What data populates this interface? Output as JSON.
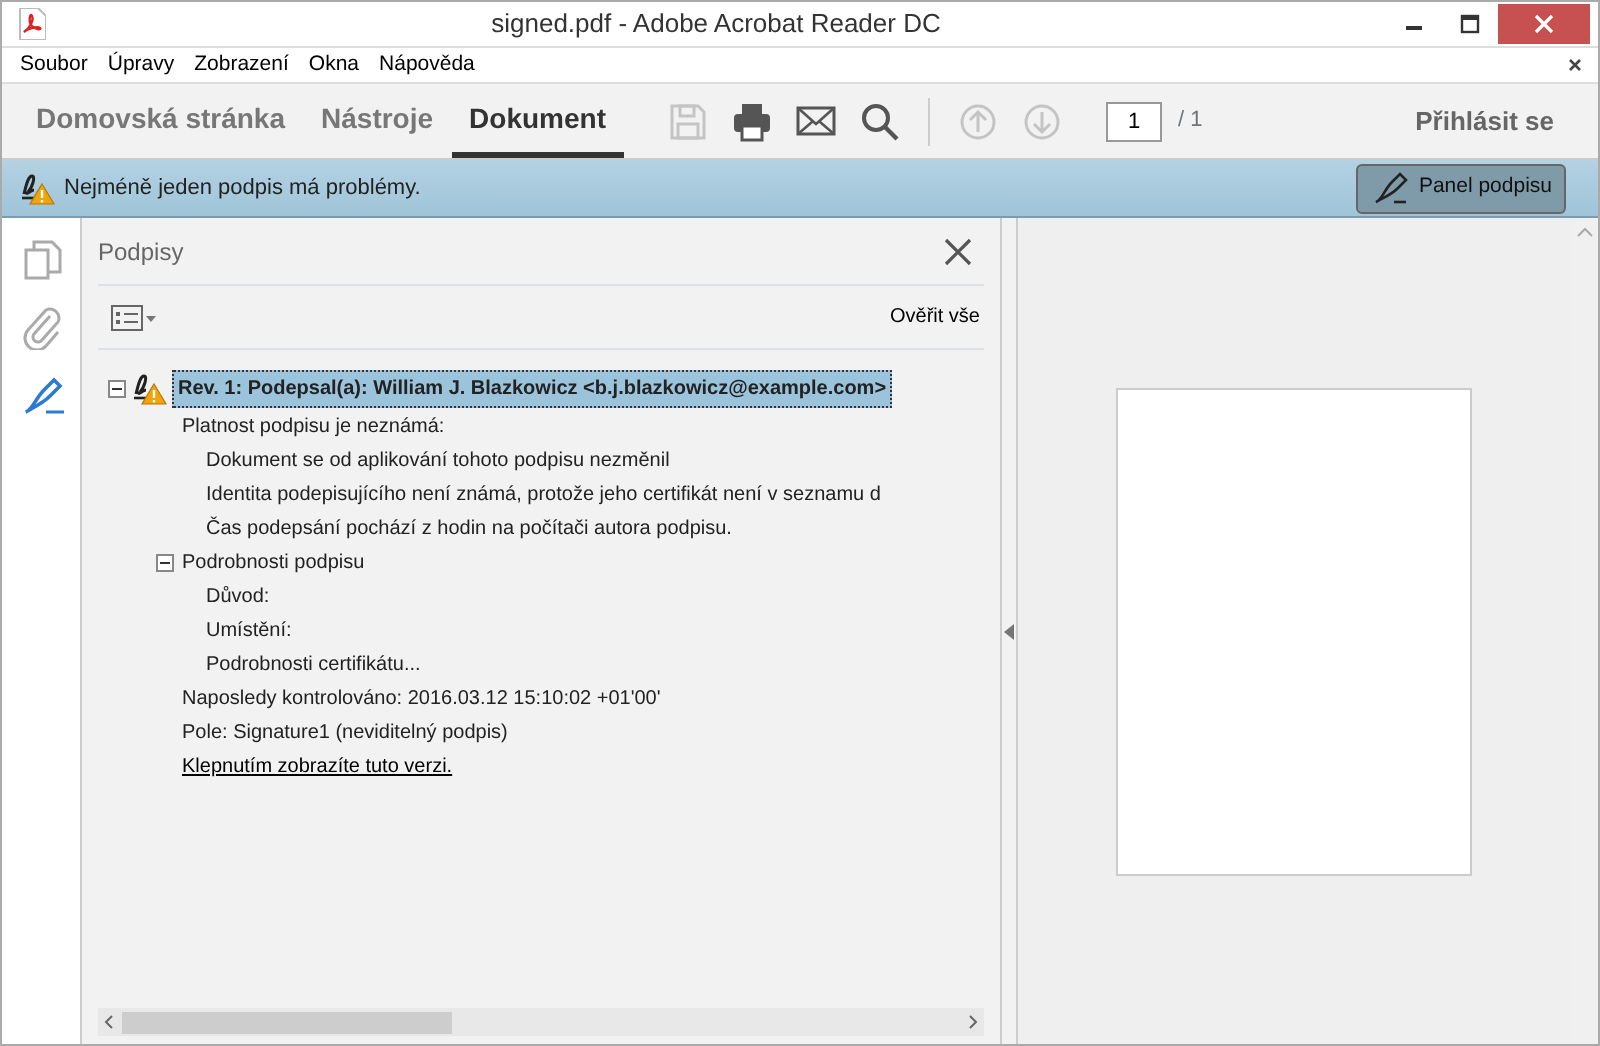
{
  "window": {
    "title": "signed.pdf - Adobe Acrobat Reader DC"
  },
  "menu": [
    "Soubor",
    "Úpravy",
    "Zobrazení",
    "Okna",
    "Nápověda"
  ],
  "toolbar": {
    "tabs": [
      {
        "label": "Domovská stránka",
        "selected": false
      },
      {
        "label": "Nástroje",
        "selected": false
      },
      {
        "label": "Dokument",
        "selected": true
      }
    ],
    "tools": [
      {
        "kind": "save",
        "disabled": true
      },
      {
        "kind": "print",
        "disabled": false
      },
      {
        "kind": "mail",
        "disabled": false
      },
      {
        "kind": "search",
        "disabled": false
      },
      {
        "kind": "separator"
      },
      {
        "kind": "prev-page",
        "disabled": true
      },
      {
        "kind": "next-page",
        "disabled": true
      }
    ],
    "page_input": "1",
    "page_total": "/ 1",
    "sign_in": "Přihlásit se"
  },
  "notification": {
    "message": "Nejméně jeden podpis má problémy.",
    "button": "Panel podpisu"
  },
  "rail": [
    {
      "kind": "pages",
      "selected": false
    },
    {
      "kind": "attachments",
      "selected": false
    },
    {
      "kind": "signatures",
      "selected": true
    }
  ],
  "panel": {
    "title": "Podpisy",
    "verify_all": "Ověřit vše",
    "tree": [
      {
        "text": "Rev. 1: Podepsal(a): William J. Blazkowicz <b.j.blazkowicz@example.com>",
        "kind": "signature",
        "selected": true,
        "expanded": true,
        "children": [
          {
            "text": "Platnost podpisu je neznámá:",
            "kind": "text",
            "children": [
              {
                "text": "Dokument se od aplikování tohoto podpisu nezměnil",
                "kind": "text"
              },
              {
                "text": "Identita podepisujícího není známá, protože jeho certifikát není v seznamu d",
                "kind": "text"
              },
              {
                "text": "Čas podepsání pochází z hodin na počítači autora podpisu.",
                "kind": "text"
              }
            ]
          },
          {
            "text": "Podrobnosti podpisu",
            "kind": "text",
            "expanded": true,
            "children": [
              {
                "text": "Důvod:",
                "kind": "text"
              },
              {
                "text": "Umístění:",
                "kind": "text"
              },
              {
                "text": "Podrobnosti certifikátu...",
                "kind": "text"
              }
            ]
          },
          {
            "text": "Naposledy kontrolováno: 2016.03.12 15:10:02 +01'00'",
            "kind": "text"
          },
          {
            "text": "Pole: Signature1 (neviditelný podpis)",
            "kind": "text"
          },
          {
            "text": "Klepnutím zobrazíte tuto verzi.",
            "kind": "link"
          }
        ]
      }
    ]
  }
}
